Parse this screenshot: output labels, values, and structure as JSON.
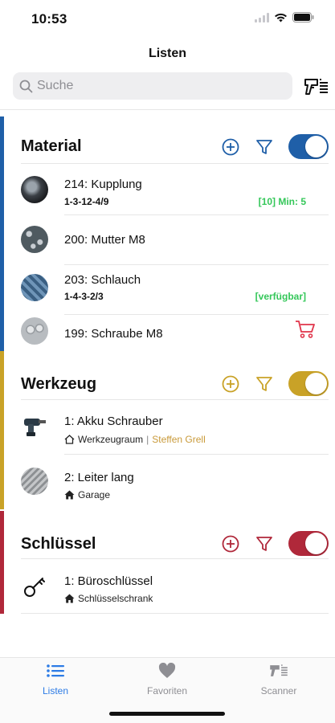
{
  "status": {
    "time": "10:53"
  },
  "nav": {
    "title": "Listen"
  },
  "search": {
    "placeholder": "Suche"
  },
  "colors": {
    "material": "#1f5fa8",
    "werkzeug": "#c9a227",
    "schluessel": "#b0283a",
    "badge_green": "#34c759",
    "cart_red": "#e0344a",
    "tab_active": "#2c7be5",
    "tab_inactive": "#8e8e93",
    "person_link": "#c99a3a"
  },
  "sections": {
    "material": {
      "title": "Material",
      "items": [
        {
          "title": "214: Kupplung",
          "sub": "1-3-12-4/9",
          "badge": "[10] Min: 5",
          "icon": "coupling-photo"
        },
        {
          "title": "200: Mutter M8",
          "icon": "nuts-photo"
        },
        {
          "title": "203: Schlauch",
          "sub": "1-4-3-2/3",
          "badge": "[verfügbar]",
          "icon": "hose-photo"
        },
        {
          "title": "199: Schraube M8",
          "icon": "screws-photo",
          "action_icon": "cart-icon"
        }
      ]
    },
    "werkzeug": {
      "title": "Werkzeug",
      "items": [
        {
          "title": "1: Akku Schrauber",
          "location": "Werkzeugraum",
          "separator": "|",
          "person": "Steffen Grell",
          "icon": "drill-photo"
        },
        {
          "title": "2: Leiter lang",
          "location": "Garage",
          "icon": "ladder-photo"
        }
      ]
    },
    "schluessel": {
      "title": "Schlüssel",
      "items": [
        {
          "title": "1: Büroschlüssel",
          "location": "Schlüsselschrank",
          "icon": "key-icon"
        }
      ]
    }
  },
  "tabs": [
    {
      "label": "Listen",
      "icon": "list-icon",
      "active": true
    },
    {
      "label": "Favoriten",
      "icon": "heart-icon",
      "active": false
    },
    {
      "label": "Scanner",
      "icon": "scanner-icon",
      "active": false
    }
  ]
}
